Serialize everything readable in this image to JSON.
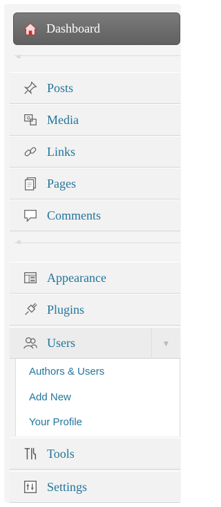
{
  "menu": {
    "dashboard": "Dashboard",
    "collapse_glyph": "«",
    "group1": [
      "Posts",
      "Media",
      "Links",
      "Pages",
      "Comments"
    ],
    "group2": [
      "Appearance",
      "Plugins",
      "Users"
    ],
    "users_sub": [
      "Authors & Users",
      "Add New",
      "Your Profile"
    ],
    "group3": [
      "Tools",
      "Settings"
    ]
  },
  "colors": {
    "link": "#21759b",
    "header_bg": "#6f6f6f"
  },
  "icons": [
    "home-icon",
    "pin-icon",
    "media-icon",
    "links-icon",
    "pages-icon",
    "comments-icon",
    "appearance-icon",
    "plugins-icon",
    "users-icon",
    "tools-icon",
    "settings-icon"
  ]
}
